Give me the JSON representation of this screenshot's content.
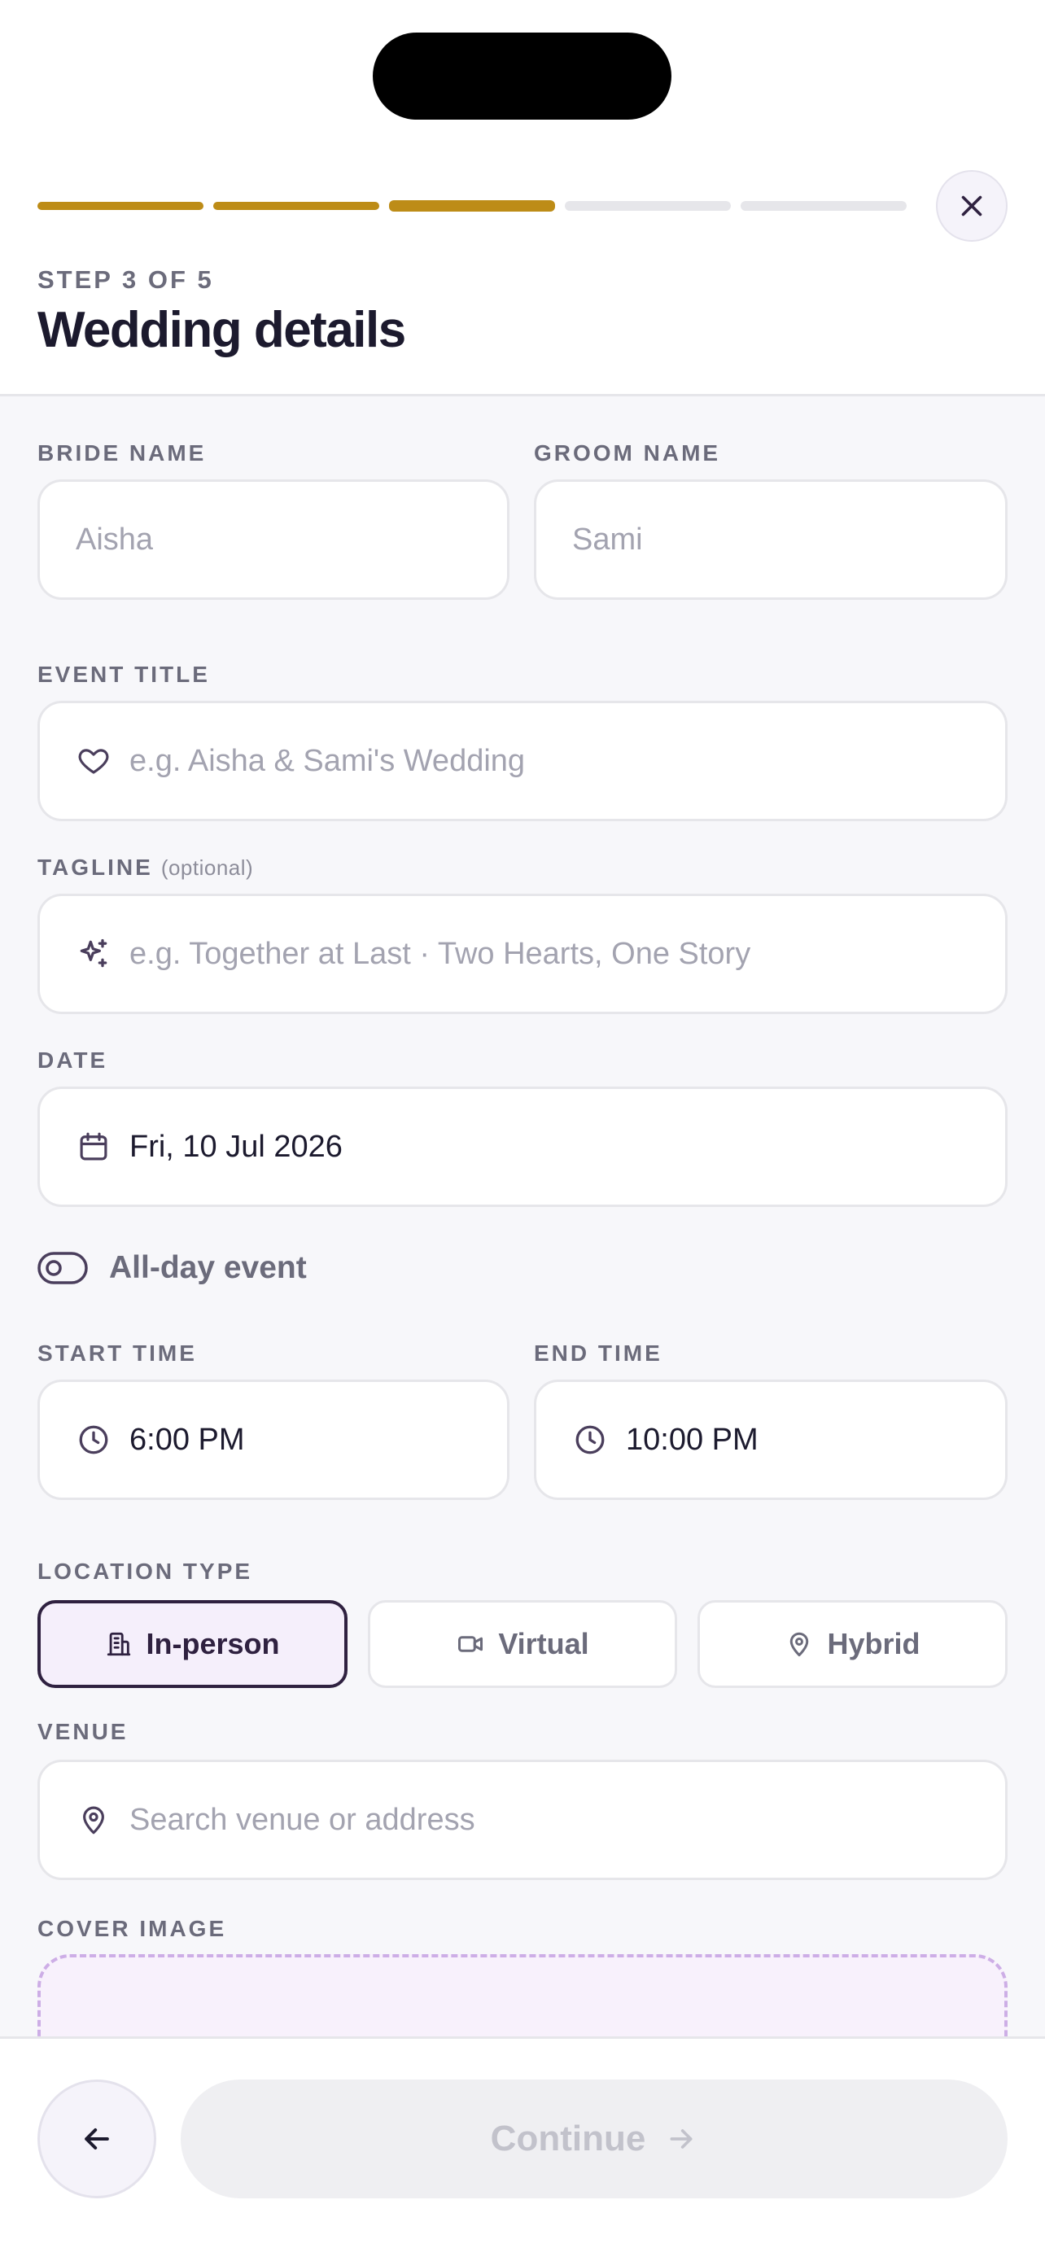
{
  "progress": {
    "total_steps": 5,
    "current_step": 3
  },
  "header": {
    "step_label": "STEP 3 OF 5",
    "title": "Wedding details",
    "close_icon": "close-icon"
  },
  "form": {
    "bride": {
      "label": "BRIDE NAME",
      "placeholder": "Aisha"
    },
    "groom": {
      "label": "GROOM NAME",
      "placeholder": "Sami"
    },
    "event_title": {
      "label": "EVENT TITLE",
      "placeholder": "e.g. Aisha & Sami's Wedding",
      "icon": "heart-icon"
    },
    "tagline": {
      "label": "TAGLINE",
      "optional": "(optional)",
      "placeholder": "e.g. Together at Last · Two Hearts, One Story",
      "icon": "sparkle-icon"
    },
    "date": {
      "label": "DATE",
      "value": "Fri, 10 Jul 2026",
      "icon": "calendar-icon"
    },
    "all_day": {
      "label": "All-day event",
      "enabled": false
    },
    "start_time": {
      "label": "START TIME",
      "value": "6:00 PM",
      "icon": "clock-icon"
    },
    "end_time": {
      "label": "END TIME",
      "value": "10:00 PM",
      "icon": "clock-icon"
    },
    "location_type": {
      "label": "LOCATION TYPE",
      "selected": "In-person",
      "options": [
        {
          "label": "In-person",
          "icon": "building-icon"
        },
        {
          "label": "Virtual",
          "icon": "video-icon"
        },
        {
          "label": "Hybrid",
          "icon": "map-pin-icon"
        }
      ]
    },
    "venue": {
      "label": "VENUE",
      "placeholder": "Search venue or address",
      "icon": "map-pin-icon"
    },
    "cover_image": {
      "label": "COVER IMAGE"
    }
  },
  "footer": {
    "back_icon": "arrow-left-icon",
    "continue_label": "Continue",
    "continue_icon": "arrow-right-icon",
    "continue_disabled": true
  },
  "colors": {
    "accent_gold": "#bd8c17",
    "selected_border": "#2f2140",
    "selected_bg": "#f5effb",
    "cover_dash": "#cdaee6"
  }
}
